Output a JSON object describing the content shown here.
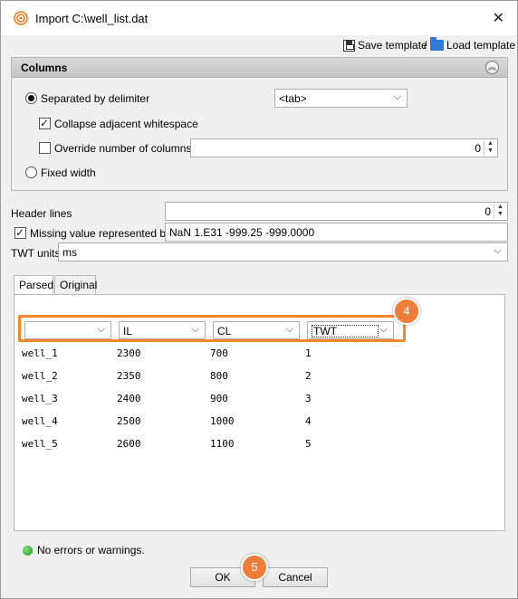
{
  "window": {
    "title": "Import C:\\well_list.dat"
  },
  "toolbar": {
    "save_template": "Save template",
    "separator": "/",
    "load_template": "Load template"
  },
  "columns_panel": {
    "header": "Columns",
    "separated_by_delimiter": "Separated by delimiter",
    "delimiter_value": "<tab>",
    "collapse_whitespace": "Collapse adjacent whitespace",
    "override_columns": "Override number of columns",
    "override_columns_value": "0",
    "fixed_width": "Fixed width"
  },
  "options": {
    "header_lines_label": "Header lines",
    "header_lines_value": "0",
    "missing_value_label": "Missing value represented by",
    "missing_value_value": "NaN 1.E31 -999.25 -999.0000",
    "twt_units_label": "TWT units",
    "twt_units_value": "ms"
  },
  "tabs": [
    {
      "label": "Parsed"
    },
    {
      "label": "Original"
    }
  ],
  "column_mapping": [
    {
      "value": ""
    },
    {
      "value": "IL"
    },
    {
      "value": "CL"
    },
    {
      "value": "TWT"
    }
  ],
  "rows": [
    [
      "well_1",
      "2300",
      "700",
      "1"
    ],
    [
      "well_2",
      "2350",
      "800",
      "2"
    ],
    [
      "well_3",
      "2400",
      "900",
      "3"
    ],
    [
      "well_4",
      "2500",
      "1000",
      "4"
    ],
    [
      "well_5",
      "2600",
      "1100",
      "5"
    ]
  ],
  "badges": {
    "step4": "4",
    "step5": "5"
  },
  "status": {
    "message": "No errors or warnings."
  },
  "buttons": {
    "ok": "OK",
    "cancel": "Cancel"
  },
  "colors": {
    "highlight": "#f5872a",
    "badge": "#f07d3a",
    "status_ok": "#1c9a1c"
  },
  "icons": {
    "app": "petrel-app-icon",
    "save": "floppy-disk-icon",
    "load": "open-folder-icon",
    "collapse": "double-chevron-up-icon",
    "status": "green-status-icon"
  }
}
